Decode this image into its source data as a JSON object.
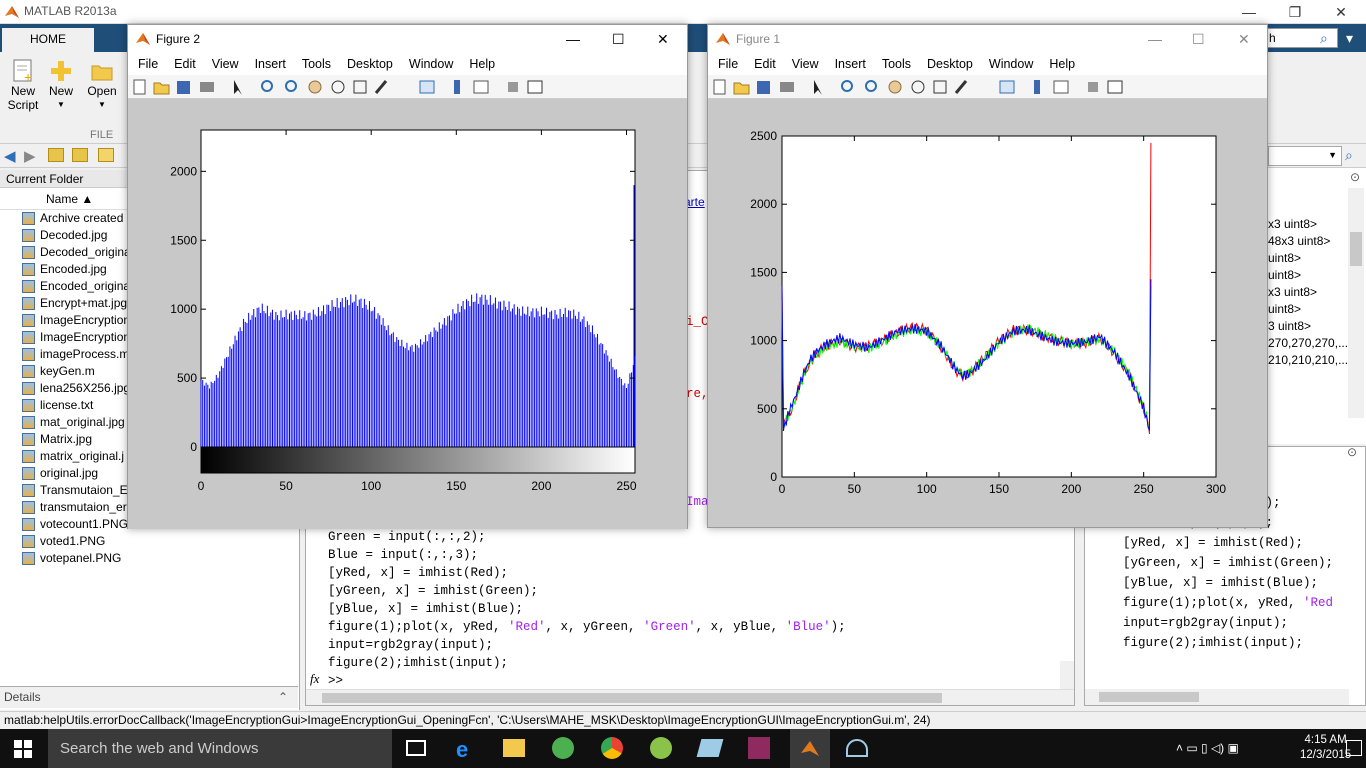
{
  "app": {
    "title": "MATLAB R2013a"
  },
  "ribbon": {
    "home_tab": "HOME",
    "new_script": "New\nScript",
    "new": "New",
    "open": "Open",
    "file_group": "FILE"
  },
  "current_folder": {
    "header": "Current Folder",
    "column_name": "Name ▲",
    "files": [
      "Archive created",
      "Decoded.jpg",
      "Decoded_origina",
      "Encoded.jpg",
      "Encoded_origina",
      "Encrypt+mat.jpg",
      "ImageEncryption",
      "ImageEncryption",
      "imageProcess.m",
      "keyGen.m",
      "lena256X256.jpg",
      "license.txt",
      "mat_original.jpg",
      "Matrix.jpg",
      "matrix_original.j",
      "original.jpg",
      "Transmutaion_E",
      "transmutaion_er",
      "votecount1.PNG",
      "voted1.PNG",
      "votepanel.PNG"
    ],
    "details": "Details"
  },
  "editor": {
    "lines": [
      "Green = input(:,:,2);",
      "Blue = input(:,:,3);",
      "[yRed, x] = imhist(Red);",
      "[yGreen, x] = imhist(Green);",
      "[yBlue, x] = imhist(Blue);",
      "figure(1);plot(x, yRed, 'Red', x, yGreen, 'Green', x, yBlue, 'Blue');",
      "input=rgb2gray(input);",
      "figure(2);imhist(input);"
    ],
    "prompt": ">>",
    "fx": "fx",
    "partial_arte": "arte",
    "partial_i_c": "i_C",
    "partial_re": "re,",
    "partial_ima": "Ima"
  },
  "workspace": {
    "items": [
      "x3 uint8>",
      "48x3 uint8>",
      "uint8>",
      "uint8>",
      "x3 uint8>",
      "uint8>",
      "3 uint8>",
      "",
      "270,270,270,...",
      "210,210,210,..."
    ]
  },
  "history": {
    "lines": [
      "\\Users\\MAH",
      ";",
      "Green = input(:,:,2);",
      "Blue = input(:,:,3);",
      "[yRed, x] = imhist(Red);",
      "[yGreen, x] = imhist(Green);",
      "[yBlue, x] = imhist(Blue);",
      "figure(1);plot(x, yRed, 'Red",
      "input=rgb2gray(input);",
      "figure(2);imhist(input);"
    ]
  },
  "statusbar": {
    "text": "matlab:helpUtils.errorDocCallback('ImageEncryptionGui>ImageEncryptionGui_OpeningFcn', 'C:\\Users\\MAHE_MSK\\Desktop\\ImageEncryptionGUI\\ImageEncryptionGui.m', 24)"
  },
  "taskbar": {
    "search": "Search the web and Windows",
    "time": "4:15 AM",
    "date": "12/3/2015"
  },
  "figure2": {
    "title": "Figure 2",
    "menu": [
      "File",
      "Edit",
      "View",
      "Insert",
      "Tools",
      "Desktop",
      "Window",
      "Help"
    ]
  },
  "figure1": {
    "title": "Figure 1",
    "menu": [
      "File",
      "Edit",
      "View",
      "Insert",
      "Tools",
      "Desktop",
      "Window",
      "Help"
    ]
  },
  "colors": {
    "red": "#ff0000",
    "green": "#00ff00",
    "blue": "#0000ff",
    "matlab_blue": "#1f4e79"
  },
  "chart_data": [
    {
      "type": "bar",
      "title": "",
      "xlabel": "",
      "ylabel": "",
      "xlim": [
        0,
        255
      ],
      "ylim": [
        0,
        2300
      ],
      "x_ticks": [
        0,
        50,
        100,
        150,
        200,
        250
      ],
      "y_ticks": [
        0,
        500,
        1000,
        1500,
        2000
      ],
      "x_tick_labels": [
        "0",
        "50",
        "100",
        "150",
        "200",
        "250"
      ],
      "y_tick_labels": [
        "0",
        "500",
        "1000",
        "1500",
        "2000"
      ],
      "series": [
        {
          "values_profile": [
            [
              0,
              480
            ],
            [
              5,
              440
            ],
            [
              10,
              520
            ],
            [
              15,
              650
            ],
            [
              20,
              780
            ],
            [
              25,
              900
            ],
            [
              30,
              960
            ],
            [
              35,
              1010
            ],
            [
              40,
              980
            ],
            [
              45,
              950
            ],
            [
              50,
              960
            ],
            [
              55,
              960
            ],
            [
              60,
              950
            ],
            [
              65,
              960
            ],
            [
              70,
              980
            ],
            [
              75,
              1020
            ],
            [
              80,
              1040
            ],
            [
              85,
              1060
            ],
            [
              90,
              1070
            ],
            [
              95,
              1050
            ],
            [
              100,
              1010
            ],
            [
              105,
              940
            ],
            [
              110,
              850
            ],
            [
              115,
              780
            ],
            [
              120,
              730
            ],
            [
              125,
              720
            ],
            [
              130,
              760
            ],
            [
              135,
              820
            ],
            [
              140,
              870
            ],
            [
              145,
              930
            ],
            [
              150,
              990
            ],
            [
              155,
              1040
            ],
            [
              160,
              1070
            ],
            [
              165,
              1080
            ],
            [
              170,
              1060
            ],
            [
              175,
              1040
            ],
            [
              180,
              1020
            ],
            [
              185,
              1000
            ],
            [
              190,
              980
            ],
            [
              195,
              980
            ],
            [
              200,
              980
            ],
            [
              205,
              970
            ],
            [
              210,
              960
            ],
            [
              215,
              980
            ],
            [
              220,
              960
            ],
            [
              225,
              920
            ],
            [
              230,
              850
            ],
            [
              235,
              750
            ],
            [
              240,
              640
            ],
            [
              245,
              520
            ],
            [
              250,
              430
            ],
            [
              255,
              640
            ]
          ]
        }
      ]
    },
    {
      "type": "line",
      "title": "",
      "xlabel": "",
      "ylabel": "",
      "xlim": [
        0,
        300
      ],
      "ylim": [
        0,
        2500
      ],
      "x_ticks": [
        0,
        50,
        100,
        150,
        200,
        250,
        300
      ],
      "y_ticks": [
        0,
        500,
        1000,
        1500,
        2000,
        2500
      ],
      "x_tick_labels": [
        "0",
        "50",
        "100",
        "150",
        "200",
        "250",
        "300"
      ],
      "y_tick_labels": [
        "0",
        "500",
        "1000",
        "1500",
        "2000",
        "2500"
      ],
      "series": [
        {
          "color": "#ff0000",
          "x": [
            0,
            1,
            5,
            10,
            15,
            20,
            25,
            30,
            40,
            50,
            60,
            70,
            80,
            90,
            100,
            110,
            120,
            125,
            130,
            140,
            150,
            160,
            170,
            180,
            190,
            200,
            210,
            220,
            230,
            240,
            250,
            254,
            255
          ],
          "values": [
            1400,
            400,
            450,
            600,
            750,
            850,
            920,
            960,
            1000,
            950,
            960,
            1000,
            1060,
            1100,
            1080,
            950,
            780,
            740,
            760,
            880,
            1000,
            1080,
            1080,
            1040,
            1000,
            980,
            980,
            1020,
            900,
            750,
            500,
            350,
            2450
          ]
        },
        {
          "color": "#00ff00",
          "x": [
            0,
            1,
            5,
            10,
            15,
            20,
            25,
            30,
            40,
            50,
            60,
            70,
            80,
            90,
            100,
            110,
            120,
            125,
            130,
            140,
            150,
            160,
            170,
            180,
            190,
            200,
            210,
            220,
            230,
            240,
            250,
            254,
            255
          ],
          "values": [
            1300,
            380,
            460,
            590,
            740,
            860,
            900,
            950,
            990,
            960,
            940,
            990,
            1050,
            1080,
            1060,
            960,
            800,
            750,
            770,
            870,
            980,
            1060,
            1090,
            1050,
            1010,
            970,
            990,
            1010,
            920,
            760,
            520,
            360,
            1400
          ]
        },
        {
          "color": "#0000ff",
          "x": [
            0,
            1,
            5,
            10,
            15,
            20,
            25,
            30,
            40,
            50,
            60,
            70,
            80,
            90,
            100,
            110,
            120,
            125,
            130,
            140,
            150,
            160,
            170,
            180,
            190,
            200,
            210,
            220,
            230,
            240,
            250,
            254,
            255
          ],
          "values": [
            1400,
            350,
            480,
            610,
            760,
            870,
            930,
            970,
            1020,
            970,
            950,
            1010,
            1070,
            1090,
            1070,
            960,
            790,
            740,
            760,
            860,
            990,
            1070,
            1080,
            1030,
            990,
            980,
            990,
            1030,
            910,
            740,
            510,
            340,
            1450
          ]
        }
      ]
    }
  ]
}
